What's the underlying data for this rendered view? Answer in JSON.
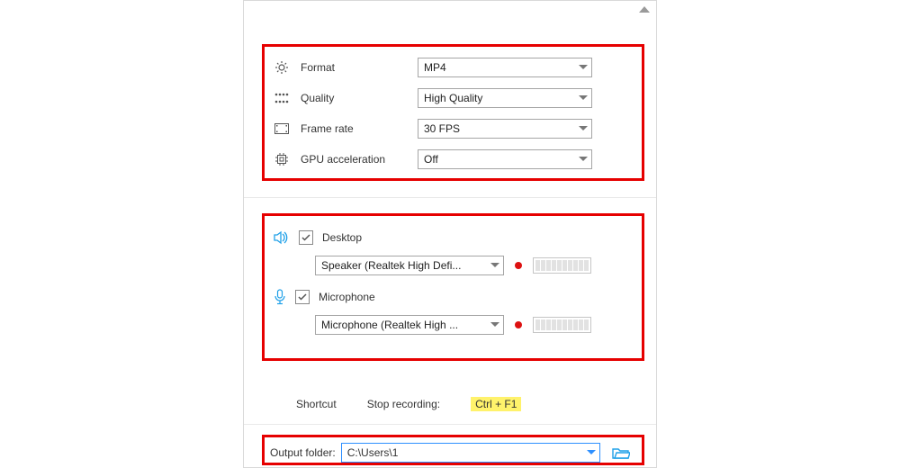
{
  "settings": {
    "format": {
      "label": "Format",
      "value": "MP4"
    },
    "quality": {
      "label": "Quality",
      "value": "High Quality"
    },
    "framerate": {
      "label": "Frame rate",
      "value": "30 FPS"
    },
    "gpu": {
      "label": "GPU acceleration",
      "value": "Off"
    }
  },
  "audio": {
    "desktop": {
      "label": "Desktop",
      "checked": true,
      "device": "Speaker (Realtek High Defi..."
    },
    "microphone": {
      "label": "Microphone",
      "checked": true,
      "device": "Microphone (Realtek High ..."
    }
  },
  "shortcut": {
    "section": "Shortcut",
    "label": "Stop recording:",
    "keys": "Ctrl + F1"
  },
  "output": {
    "label": "Output folder:",
    "path": "C:\\Users\\1"
  },
  "icons": {
    "collapse": "triangle-up",
    "folder": "folder-open"
  }
}
